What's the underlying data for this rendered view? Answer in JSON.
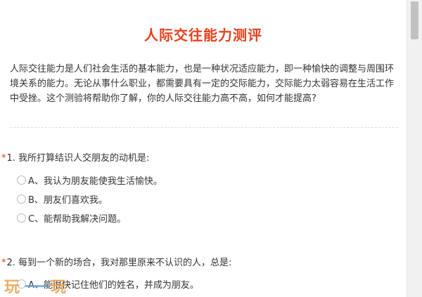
{
  "title": "人际交往能力测评",
  "intro": "人际交往能力是人们社会生活的基本能力，也是一种状况适应能力，即一种愉快的调整与周围环境关系的能力。无论从事什么职业，都需要具有一定的交际能力，交际能力太弱容易在生活工作中受挫。这个测验将帮助你了解，你的人际交往能力高不高，如何才能提高?",
  "questions": [
    {
      "required_mark": "*",
      "number_title": "1. 我所打算结识人交朋友的动机是:",
      "options": [
        {
          "label": "A、我认为朋友能使我生活愉快。"
        },
        {
          "label": "B、朋友们喜欢我。"
        },
        {
          "label": "C、能帮助我解决问题。"
        }
      ]
    },
    {
      "required_mark": "*",
      "number_title": "2. 每到一个新的场合，我对那里原来不认识的人，总是:",
      "options": [
        {
          "label": "A、能很快记住他们的姓名，并成为朋友。"
        }
      ]
    }
  ],
  "watermark": {
    "left": "玩",
    "right": "玩"
  }
}
